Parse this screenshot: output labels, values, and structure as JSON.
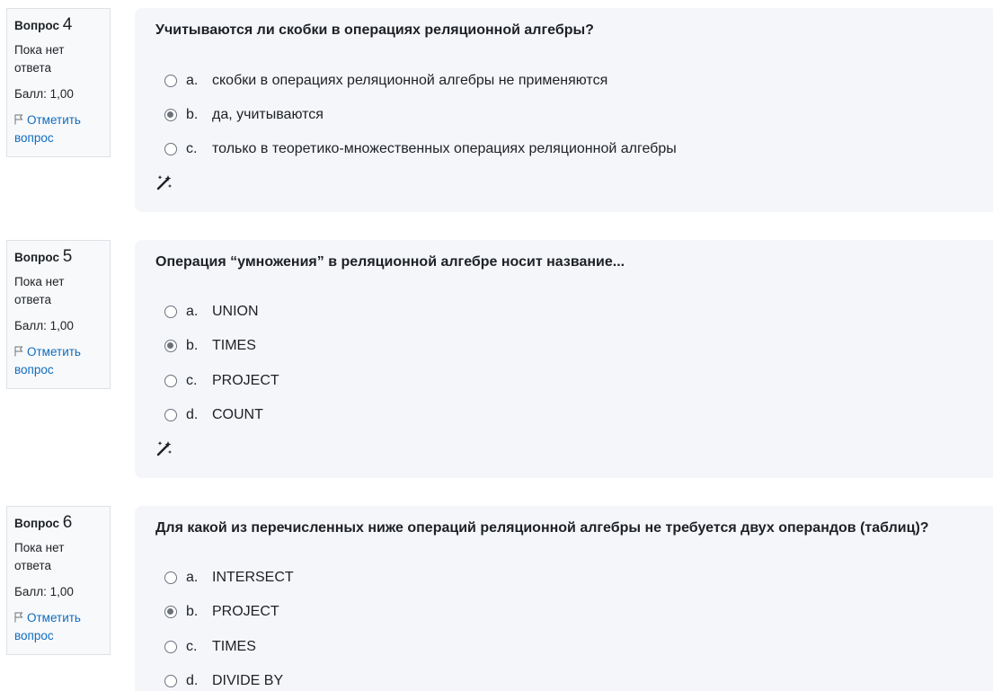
{
  "questions": [
    {
      "label": "Вопрос",
      "number": "4",
      "state": "Пока нет ответа",
      "grade": "Балл: 1,00",
      "flag": "Отметить вопрос",
      "text": "Учитываются ли скобки в операциях реляционной алгебры?",
      "options": [
        {
          "letter": "a.",
          "text": "скобки в операциях реляционной алгебры не применяются",
          "checked": false
        },
        {
          "letter": "b.",
          "text": "да, учитываются",
          "checked": true
        },
        {
          "letter": "c.",
          "text": "только в теоретико-множественных операциях реляционной алгебры",
          "checked": false
        }
      ],
      "tool_icon": "magic-wand-icon"
    },
    {
      "label": "Вопрос",
      "number": "5",
      "state": "Пока нет ответа",
      "grade": "Балл: 1,00",
      "flag": "Отметить вопрос",
      "text": "Операция “умножения” в реляционной алгебре носит название...",
      "options": [
        {
          "letter": "a.",
          "text": "UNION",
          "checked": false
        },
        {
          "letter": "b.",
          "text": "TIMES",
          "checked": true
        },
        {
          "letter": "c.",
          "text": "PROJECT",
          "checked": false
        },
        {
          "letter": "d.",
          "text": "COUNT",
          "checked": false
        }
      ],
      "tool_icon": "magic-wand-icon"
    },
    {
      "label": "Вопрос",
      "number": "6",
      "state": "Пока нет ответа",
      "grade": "Балл: 1,00",
      "flag": "Отметить вопрос",
      "text": "Для какой из перечисленных ниже операций реляционной алгебры не требуется двух операндов (таблиц)?",
      "options": [
        {
          "letter": "a.",
          "text": "INTERSECT",
          "checked": false
        },
        {
          "letter": "b.",
          "text": "PROJECT",
          "checked": true
        },
        {
          "letter": "c.",
          "text": "TIMES",
          "checked": false
        },
        {
          "letter": "d.",
          "text": "DIVIDE BY",
          "checked": false
        }
      ]
    }
  ],
  "colors": {
    "link": "#0f6cbf",
    "panel": "#f5f6fa",
    "info_bg": "#f8f9fa",
    "radio": "#6a737b"
  }
}
